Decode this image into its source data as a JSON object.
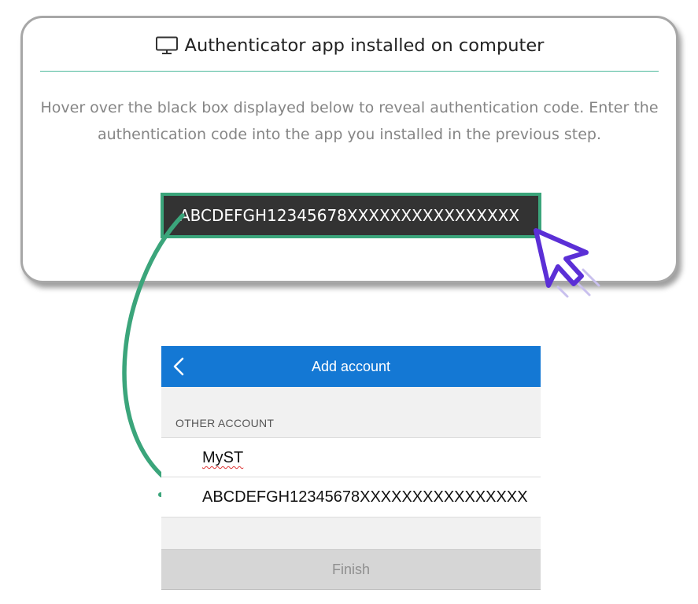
{
  "card": {
    "title": "Authenticator app installed on computer",
    "description": "Hover over the black box displayed below to reveal authentication code. Enter the authentication code into the app you installed in the previous step.",
    "code": "ABCDEFGH12345678XXXXXXXXXXXXXXXX",
    "title_icon": "monitor-icon"
  },
  "phone": {
    "header_title": "Add account",
    "back_icon": "chevron-left-icon",
    "section_label": "OTHER ACCOUNT",
    "account_name": "MyST",
    "secret_key": "ABCDEFGH12345678XXXXXXXXXXXXXXXX",
    "finish_label": "Finish"
  },
  "colors": {
    "accent_green": "#3ba57b",
    "header_blue": "#1478d4",
    "cursor_purple": "#5b2fd6"
  }
}
